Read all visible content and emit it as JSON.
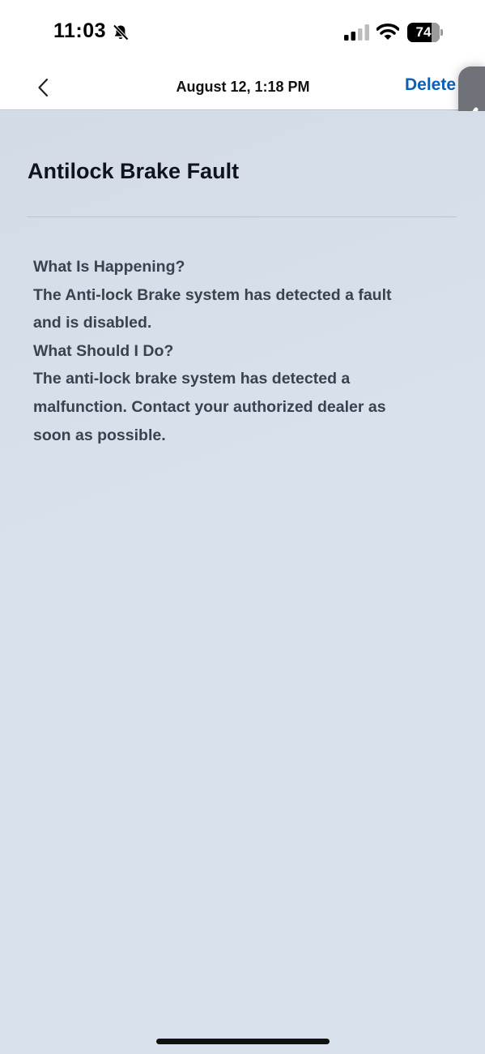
{
  "status_bar": {
    "time": "11:03",
    "battery_level": "74",
    "battery_fraction": 0.74,
    "icons": [
      "bell-slash-icon",
      "cellular-signal-icon",
      "wifi-icon",
      "battery-icon"
    ]
  },
  "nav": {
    "back_icon": "chevron-left-icon",
    "title": "August 12, 1:18 PM",
    "delete_label": "Delete"
  },
  "side_handle": {
    "icon": "chevron-left-icon"
  },
  "page": {
    "title": "Antilock Brake Fault"
  },
  "message": {
    "lines": [
      "What Is Happening?",
      "The Anti-lock Brake system has detected a fault",
      "and is disabled.",
      "What Should I Do?",
      "The anti-lock brake system has detected a",
      "malfunction. Contact your authorized dealer as",
      "soon as possible."
    ]
  },
  "colors": {
    "accent": "#0b5fb5",
    "background": "#d9e1ec",
    "body_text": "#3a4150",
    "title_text": "#0f1420"
  }
}
